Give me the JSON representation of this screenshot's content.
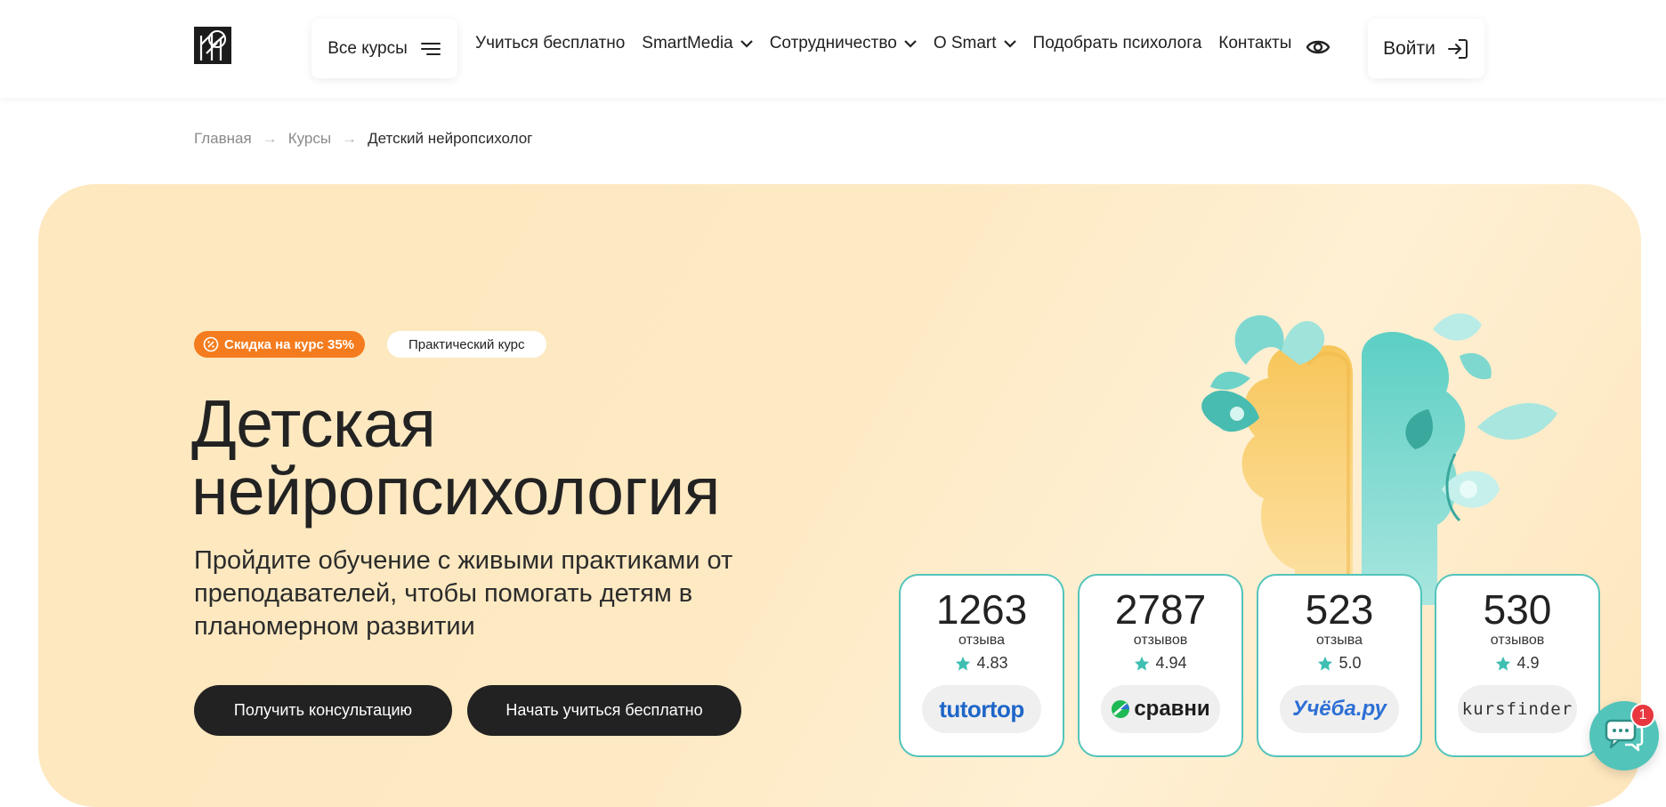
{
  "header": {
    "courses_label": "Все курсы",
    "nav": [
      {
        "label": "Учиться бесплатно",
        "dropdown": false
      },
      {
        "label": "SmartMedia",
        "dropdown": true
      },
      {
        "label": "Сотрудничество",
        "dropdown": true
      },
      {
        "label": "О Smart",
        "dropdown": true
      },
      {
        "label": "Подобрать психолога",
        "dropdown": false
      },
      {
        "label": "Контакты",
        "dropdown": false
      }
    ],
    "login_label": "Войти"
  },
  "breadcrumb": {
    "items": [
      "Главная",
      "Курсы"
    ],
    "separator": "→",
    "current": "Детский нейропсихолог"
  },
  "hero": {
    "discount_badge": "Скидка на курс 35%",
    "type_badge": "Практический курс",
    "title_line1": "Детская",
    "title_line2": "нейропсихология",
    "subtitle": "Пройдите обучение с живыми практиками от преподавателей, чтобы помогать детям в планомерном развитии",
    "consult_button": "Получить консультацию",
    "free_button": "Начать учиться бесплатно"
  },
  "reviews": [
    {
      "count": "1263",
      "word": "отзыва",
      "rating": "4.83",
      "platform": "tutortop"
    },
    {
      "count": "2787",
      "word": "отзывов",
      "rating": "4.94",
      "platform": "сравни"
    },
    {
      "count": "523",
      "word": "отзыва",
      "rating": "5.0",
      "platform": "Учёба.ру"
    },
    {
      "count": "530",
      "word": "отзывов",
      "rating": "4.9",
      "platform": "kursfinder"
    }
  ],
  "chat": {
    "badge": "1"
  },
  "colors": {
    "accent_teal": "#52c4ba",
    "accent_orange": "#f47c1e",
    "dark": "#222222",
    "hero_bg": "#fde8bf"
  }
}
